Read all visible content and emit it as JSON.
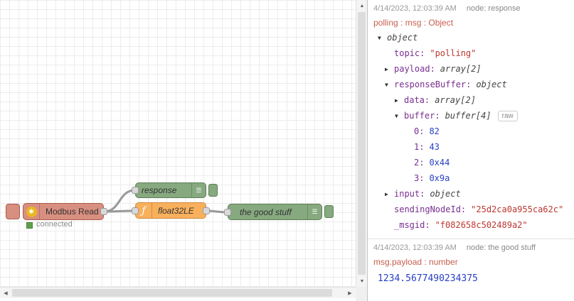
{
  "icons": {
    "modbus_gear": "✱",
    "function_f": "ƒ",
    "debug_list": "☰",
    "collapse_down": "▼",
    "collapse_right": "▶",
    "scroll_up": "▲",
    "scroll_down": "▼",
    "scroll_left": "◀",
    "scroll_right": "▶"
  },
  "colors": {
    "debug_node_green": "#87a980",
    "function_node_orange": "#f9b05c",
    "modbus_node_salmon": "#d98f80",
    "status_green": "#5fa04e",
    "key_purple": "#792e90",
    "string_red": "#bd362f",
    "number_blue": "#2840c4",
    "path_salmon": "#c65f4e"
  },
  "canvas": {
    "nodes": {
      "modbus": {
        "label": "Modbus Read",
        "status": "connected"
      },
      "response": {
        "label": "response"
      },
      "float32": {
        "label": "float32LE"
      },
      "goodstuff": {
        "label": "the good stuff"
      }
    }
  },
  "debug": {
    "messages": [
      {
        "timestamp": "4/14/2023, 12:03:39 AM",
        "node": "node: response",
        "path": "polling : msg : Object",
        "raw_label": "raw",
        "tree": [
          {
            "value": "object"
          },
          {
            "key": "topic:",
            "value": "\"polling\""
          },
          {
            "key": "payload:",
            "value": "array[2]"
          },
          {
            "key": "responseBuffer:",
            "value": "object"
          },
          {
            "key": "data:",
            "value": "array[2]"
          },
          {
            "key": "buffer:",
            "value": "buffer[4]"
          },
          {
            "key": "0:",
            "value": "82"
          },
          {
            "key": "1:",
            "value": "43"
          },
          {
            "key": "2:",
            "value": "0x44"
          },
          {
            "key": "3:",
            "value": "0x9a"
          },
          {
            "key": "input:",
            "value": "object"
          },
          {
            "key": "sendingNodeId:",
            "value": "\"25d2ca0a955ca62c\""
          },
          {
            "key": "_msgid:",
            "value": "\"f082658c502489a2\""
          }
        ]
      },
      {
        "timestamp": "4/14/2023, 12:03:39 AM",
        "node": "node: the good stuff",
        "path": "msg.payload : number",
        "value": "1234.5677490234375"
      }
    ]
  }
}
